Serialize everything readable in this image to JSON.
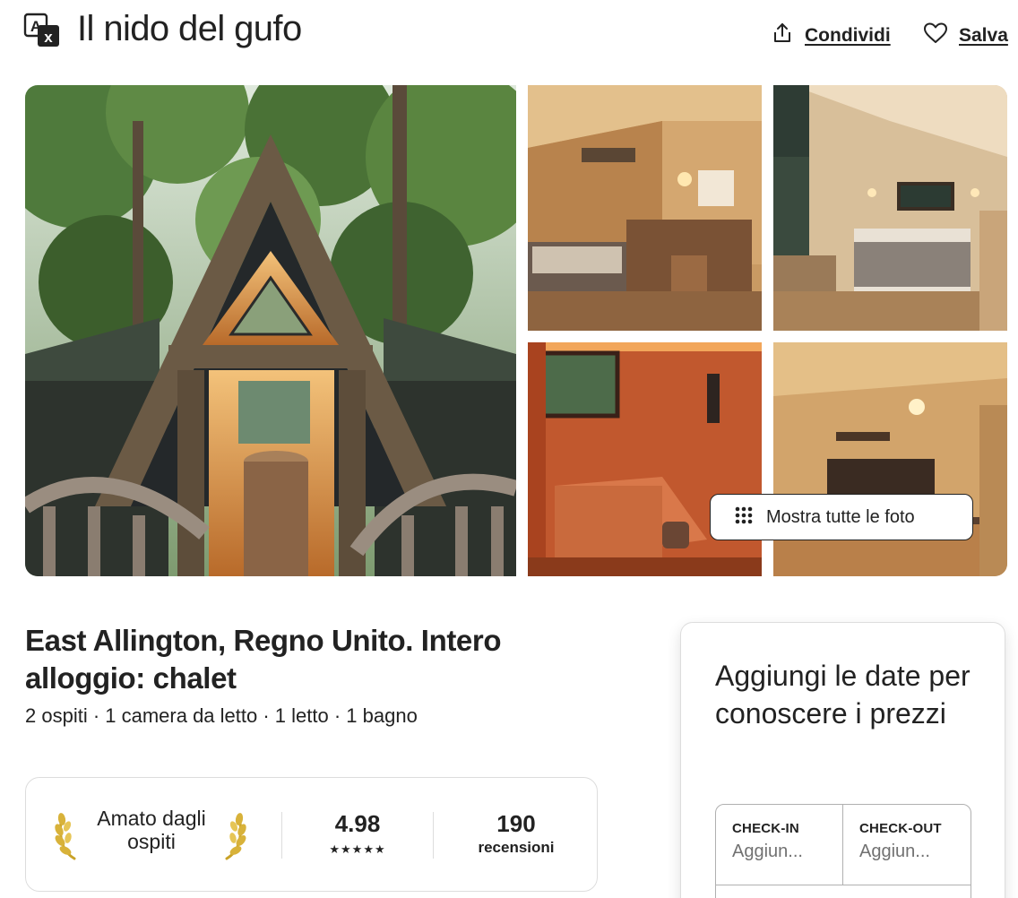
{
  "header": {
    "title": "Il nido del gufo",
    "share_label": "Condividi",
    "save_label": "Salva",
    "translate_icon": "translate-icon",
    "share_icon": "share-icon",
    "save_icon": "heart-icon"
  },
  "gallery": {
    "show_all_label": "Mostra tutte le foto",
    "show_all_icon": "grid-dots-icon"
  },
  "listing": {
    "title": "East Allington, Regno Unito. Intero alloggio: chalet",
    "subtitle": "2 ospiti · 1 camera da letto · 1 letto · 1 bagno"
  },
  "guest_favorite": {
    "label": "Amato dagli ospiti",
    "rating": "4.98",
    "stars": "★★★★★",
    "reviews_count": "190",
    "reviews_label": "recensioni"
  },
  "booking": {
    "heading": "Aggiungi le date per conoscere i prezzi",
    "checkin_label": "CHECK-IN",
    "checkin_placeholder": "Aggiun...",
    "checkout_label": "CHECK-OUT",
    "checkout_placeholder": "Aggiun..."
  },
  "colors": {
    "text": "#222222",
    "muted": "#717171",
    "border": "#dddddd",
    "laurel": "#c9a227"
  }
}
